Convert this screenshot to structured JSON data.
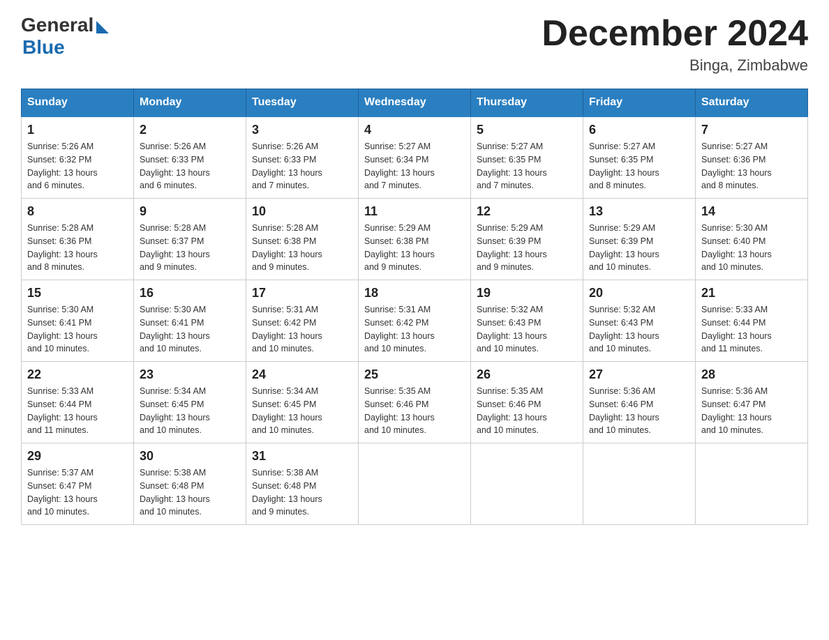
{
  "logo": {
    "general_text": "General",
    "blue_text": "Blue"
  },
  "title": {
    "month_year": "December 2024",
    "location": "Binga, Zimbabwe"
  },
  "days_of_week": [
    "Sunday",
    "Monday",
    "Tuesday",
    "Wednesday",
    "Thursday",
    "Friday",
    "Saturday"
  ],
  "weeks": [
    [
      {
        "num": "1",
        "sunrise": "5:26 AM",
        "sunset": "6:32 PM",
        "daylight": "13 hours and 6 minutes."
      },
      {
        "num": "2",
        "sunrise": "5:26 AM",
        "sunset": "6:33 PM",
        "daylight": "13 hours and 6 minutes."
      },
      {
        "num": "3",
        "sunrise": "5:26 AM",
        "sunset": "6:33 PM",
        "daylight": "13 hours and 7 minutes."
      },
      {
        "num": "4",
        "sunrise": "5:27 AM",
        "sunset": "6:34 PM",
        "daylight": "13 hours and 7 minutes."
      },
      {
        "num": "5",
        "sunrise": "5:27 AM",
        "sunset": "6:35 PM",
        "daylight": "13 hours and 7 minutes."
      },
      {
        "num": "6",
        "sunrise": "5:27 AM",
        "sunset": "6:35 PM",
        "daylight": "13 hours and 8 minutes."
      },
      {
        "num": "7",
        "sunrise": "5:27 AM",
        "sunset": "6:36 PM",
        "daylight": "13 hours and 8 minutes."
      }
    ],
    [
      {
        "num": "8",
        "sunrise": "5:28 AM",
        "sunset": "6:36 PM",
        "daylight": "13 hours and 8 minutes."
      },
      {
        "num": "9",
        "sunrise": "5:28 AM",
        "sunset": "6:37 PM",
        "daylight": "13 hours and 9 minutes."
      },
      {
        "num": "10",
        "sunrise": "5:28 AM",
        "sunset": "6:38 PM",
        "daylight": "13 hours and 9 minutes."
      },
      {
        "num": "11",
        "sunrise": "5:29 AM",
        "sunset": "6:38 PM",
        "daylight": "13 hours and 9 minutes."
      },
      {
        "num": "12",
        "sunrise": "5:29 AM",
        "sunset": "6:39 PM",
        "daylight": "13 hours and 9 minutes."
      },
      {
        "num": "13",
        "sunrise": "5:29 AM",
        "sunset": "6:39 PM",
        "daylight": "13 hours and 10 minutes."
      },
      {
        "num": "14",
        "sunrise": "5:30 AM",
        "sunset": "6:40 PM",
        "daylight": "13 hours and 10 minutes."
      }
    ],
    [
      {
        "num": "15",
        "sunrise": "5:30 AM",
        "sunset": "6:41 PM",
        "daylight": "13 hours and 10 minutes."
      },
      {
        "num": "16",
        "sunrise": "5:30 AM",
        "sunset": "6:41 PM",
        "daylight": "13 hours and 10 minutes."
      },
      {
        "num": "17",
        "sunrise": "5:31 AM",
        "sunset": "6:42 PM",
        "daylight": "13 hours and 10 minutes."
      },
      {
        "num": "18",
        "sunrise": "5:31 AM",
        "sunset": "6:42 PM",
        "daylight": "13 hours and 10 minutes."
      },
      {
        "num": "19",
        "sunrise": "5:32 AM",
        "sunset": "6:43 PM",
        "daylight": "13 hours and 10 minutes."
      },
      {
        "num": "20",
        "sunrise": "5:32 AM",
        "sunset": "6:43 PM",
        "daylight": "13 hours and 10 minutes."
      },
      {
        "num": "21",
        "sunrise": "5:33 AM",
        "sunset": "6:44 PM",
        "daylight": "13 hours and 11 minutes."
      }
    ],
    [
      {
        "num": "22",
        "sunrise": "5:33 AM",
        "sunset": "6:44 PM",
        "daylight": "13 hours and 11 minutes."
      },
      {
        "num": "23",
        "sunrise": "5:34 AM",
        "sunset": "6:45 PM",
        "daylight": "13 hours and 10 minutes."
      },
      {
        "num": "24",
        "sunrise": "5:34 AM",
        "sunset": "6:45 PM",
        "daylight": "13 hours and 10 minutes."
      },
      {
        "num": "25",
        "sunrise": "5:35 AM",
        "sunset": "6:46 PM",
        "daylight": "13 hours and 10 minutes."
      },
      {
        "num": "26",
        "sunrise": "5:35 AM",
        "sunset": "6:46 PM",
        "daylight": "13 hours and 10 minutes."
      },
      {
        "num": "27",
        "sunrise": "5:36 AM",
        "sunset": "6:46 PM",
        "daylight": "13 hours and 10 minutes."
      },
      {
        "num": "28",
        "sunrise": "5:36 AM",
        "sunset": "6:47 PM",
        "daylight": "13 hours and 10 minutes."
      }
    ],
    [
      {
        "num": "29",
        "sunrise": "5:37 AM",
        "sunset": "6:47 PM",
        "daylight": "13 hours and 10 minutes."
      },
      {
        "num": "30",
        "sunrise": "5:38 AM",
        "sunset": "6:48 PM",
        "daylight": "13 hours and 10 minutes."
      },
      {
        "num": "31",
        "sunrise": "5:38 AM",
        "sunset": "6:48 PM",
        "daylight": "13 hours and 9 minutes."
      },
      null,
      null,
      null,
      null
    ]
  ],
  "labels": {
    "sunrise": "Sunrise:",
    "sunset": "Sunset:",
    "daylight": "Daylight:"
  }
}
